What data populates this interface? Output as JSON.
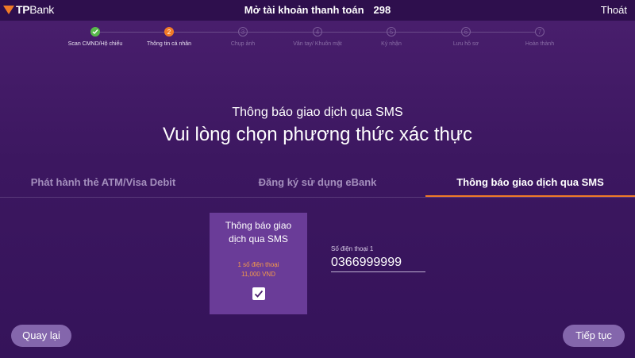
{
  "header": {
    "logo_tp": "TP",
    "logo_bank": "Bank",
    "title": "Mở tài khoản thanh toán",
    "number": "298",
    "exit_label": "Thoát"
  },
  "stepper": {
    "steps": [
      {
        "num": "",
        "label": "Scan CMND/Hộ chiếu",
        "state": "done"
      },
      {
        "num": "2",
        "label": "Thông tin cá nhân",
        "state": "active"
      },
      {
        "num": "3",
        "label": "Chụp ảnh",
        "state": "pending"
      },
      {
        "num": "4",
        "label": "Vân tay/ Khuôn mặt",
        "state": "pending"
      },
      {
        "num": "5",
        "label": "Ký nhận",
        "state": "pending"
      },
      {
        "num": "6",
        "label": "Lưu hồ sơ",
        "state": "pending"
      },
      {
        "num": "7",
        "label": "Hoàn thành",
        "state": "pending"
      }
    ]
  },
  "main": {
    "subtitle": "Thông báo giao dịch qua SMS",
    "heading": "Vui lòng chọn phương thức xác thực",
    "tabs": [
      {
        "label": "Phát hành thẻ ATM/Visa Debit",
        "active": false
      },
      {
        "label": "Đăng ký sử dụng eBank",
        "active": false
      },
      {
        "label": "Thông báo giao dịch qua SMS",
        "active": true
      }
    ],
    "card": {
      "title_line1": "Thông báo giao",
      "title_line2": "dịch qua SMS",
      "note_line1": "1 số điện thoại",
      "note_line2": "11,000 VND",
      "checked": true
    },
    "phone": {
      "label": "Số điện thoại 1",
      "value": "0366999999"
    }
  },
  "footer": {
    "back_label": "Quay lại",
    "next_label": "Tiếp tục"
  },
  "colors": {
    "accent": "#f07a27",
    "done": "#58b84a",
    "background": "#3c1760"
  }
}
